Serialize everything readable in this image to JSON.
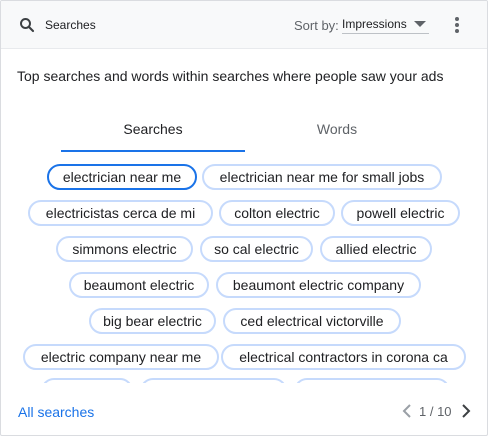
{
  "topbar": {
    "search_label": "Searches",
    "sort_by_label": "Sort by:",
    "sort_value": "Impressions"
  },
  "card": {
    "title": "Top searches and words within searches where people saw your ads"
  },
  "tabs": [
    {
      "label": "Searches",
      "selected": true
    },
    {
      "label": "Words",
      "selected": false
    }
  ],
  "chips": [
    {
      "label": "electrician near me",
      "selected": true
    },
    {
      "label": "electrician near me for small jobs"
    },
    {
      "label": "electricistas cerca de mi"
    },
    {
      "label": "colton electric"
    },
    {
      "label": "powell electric"
    },
    {
      "label": "simmons electric"
    },
    {
      "label": "so cal electric"
    },
    {
      "label": "allied electric"
    },
    {
      "label": "beaumont electric"
    },
    {
      "label": "beaumont electric company"
    },
    {
      "label": "big bear electric"
    },
    {
      "label": "ced electrical victorville"
    },
    {
      "label": "electric company near me"
    },
    {
      "label": "electrical contractors in corona ca"
    },
    {
      "label": ""
    },
    {
      "label": ""
    },
    {
      "label": ""
    }
  ],
  "footer": {
    "all_searches_label": "All searches",
    "pagination": "1 / 10"
  },
  "colors": {
    "accent": "#1a73e8",
    "chip_border": "#c6dafc",
    "text": "#202124",
    "secondary_text": "#5f6368"
  }
}
